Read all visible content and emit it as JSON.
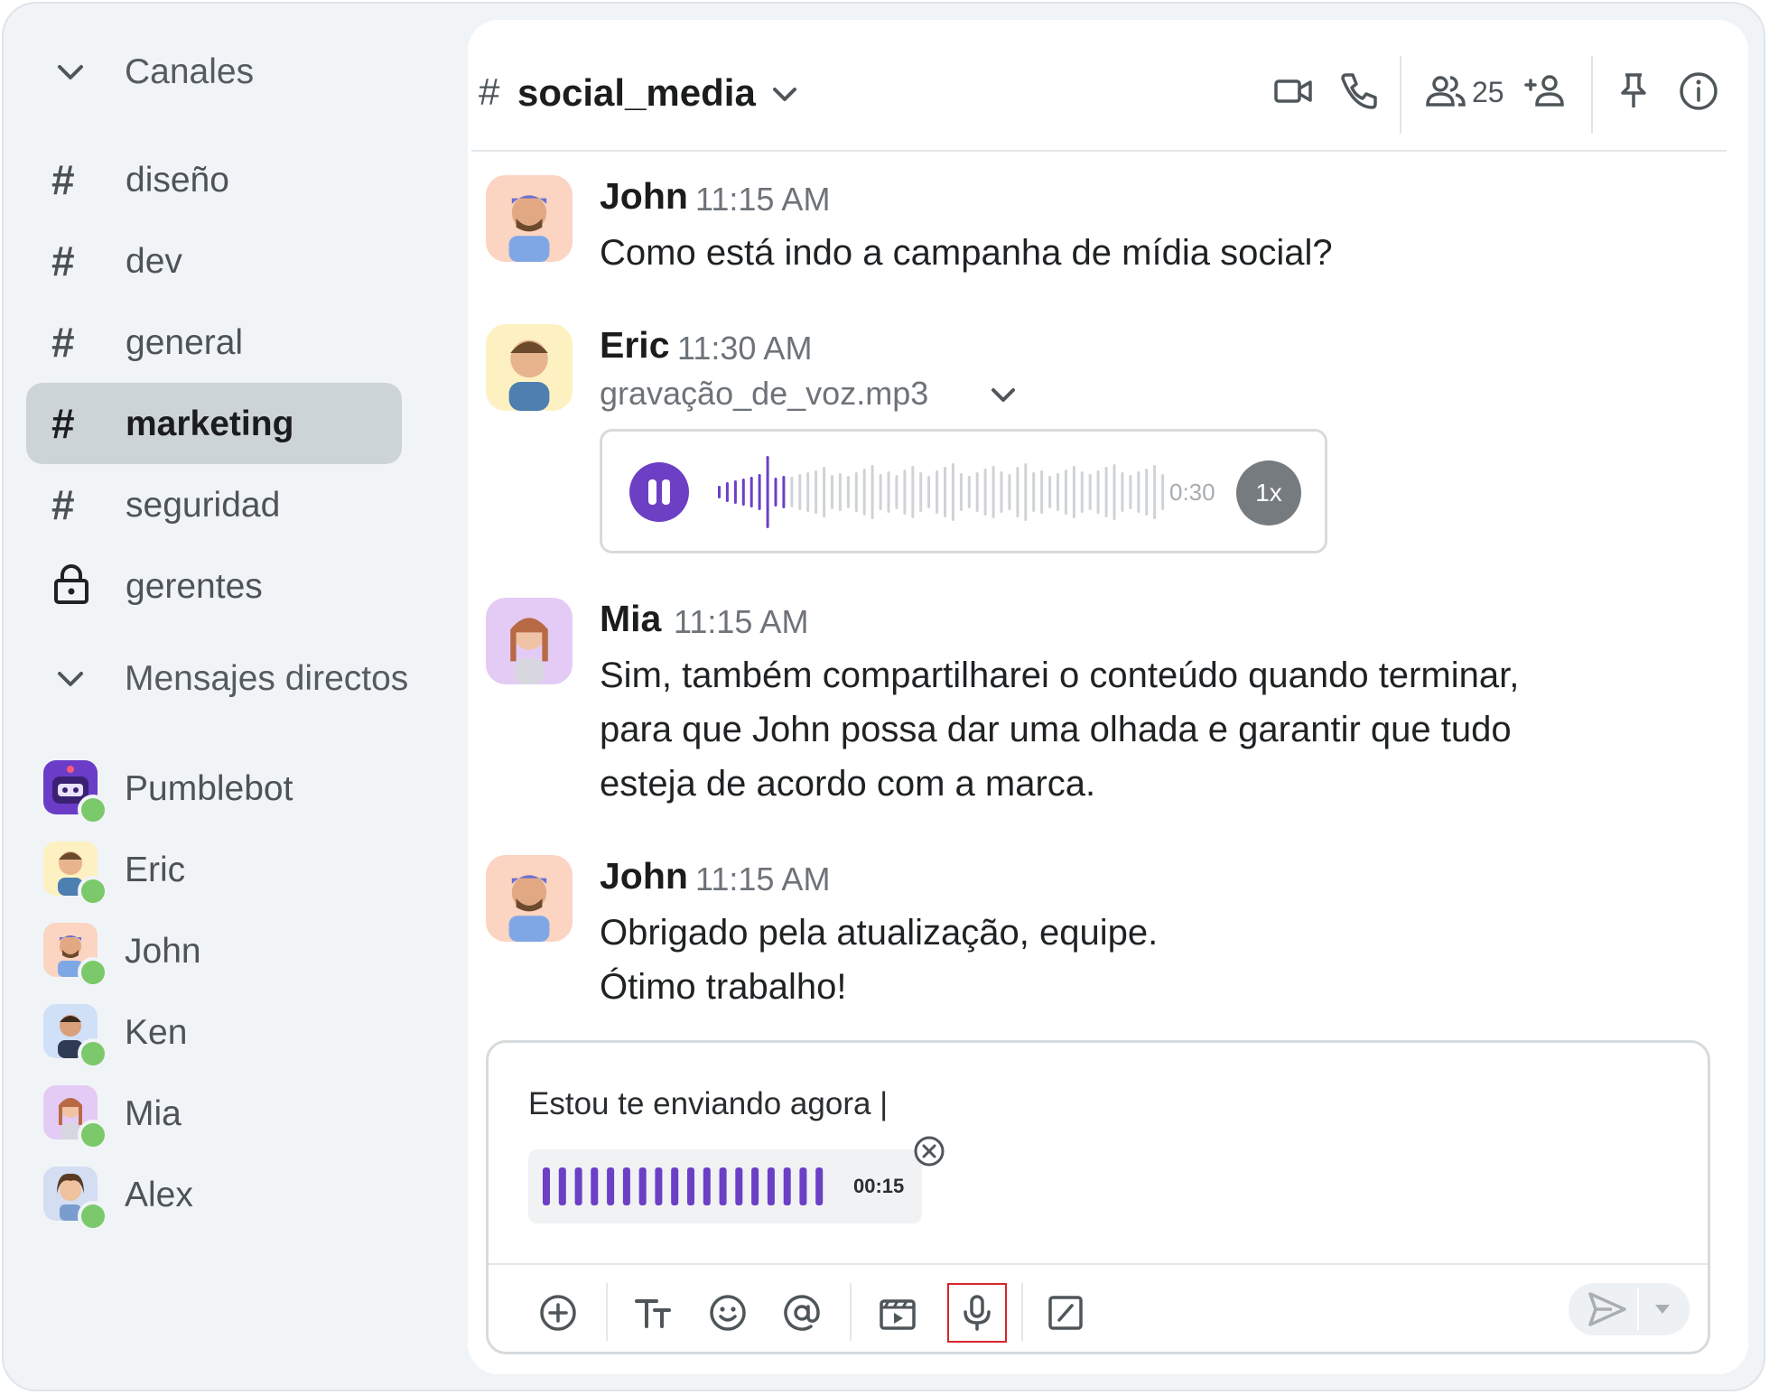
{
  "sidebar": {
    "channels_header": "Canales",
    "channels": [
      {
        "symbol": "#",
        "label": "diseño"
      },
      {
        "symbol": "#",
        "label": "dev"
      },
      {
        "symbol": "#",
        "label": "general"
      },
      {
        "symbol": "#",
        "label": "marketing",
        "active": true
      },
      {
        "symbol": "#",
        "label": "seguridad"
      },
      {
        "symbol": "lock-icon",
        "label": "gerentes"
      }
    ],
    "dm_header": "Mensajes directos",
    "direct_messages": [
      {
        "name": "Pumblebot",
        "status": "online"
      },
      {
        "name": "Eric",
        "status": "online"
      },
      {
        "name": "John",
        "status": "online"
      },
      {
        "name": "Ken",
        "status": "online"
      },
      {
        "name": "Mia",
        "status": "online"
      },
      {
        "name": "Alex",
        "status": "online"
      }
    ]
  },
  "channel": {
    "hash": "#",
    "name": "social_media",
    "member_count": "25",
    "icons": [
      "video-camera-icon",
      "phone-icon",
      "members-icon",
      "add-member-icon",
      "pin-icon",
      "info-icon"
    ]
  },
  "messages": [
    {
      "author": "John",
      "time": "11:15 AM",
      "text": "Como está indo a campanha de mídia social?"
    },
    {
      "author": "Eric",
      "time": "11:30 AM",
      "attachment": {
        "filename": "gravação_de_voz.mp3",
        "duration": "0:30",
        "speed": "1x",
        "progress": 0.16
      }
    },
    {
      "author": "Mia",
      "time": "11:15 AM",
      "lines": [
        "Sim, também compartilharei o conteúdo quando terminar,",
        "para que John possa dar uma olhada e garantir que tudo",
        "esteja de acordo com a marca."
      ]
    },
    {
      "author": "John",
      "time": "11:15 AM",
      "lines": [
        "Obrigado pela atualização, equipe.",
        "Ótimo trabalho!"
      ]
    }
  ],
  "composer": {
    "input_value": "Estou te enviando agora |",
    "recording_time": "00:15",
    "toolbar": [
      "add-icon",
      "text-format-icon",
      "emoji-icon",
      "mention-icon",
      "media-icon",
      "microphone-icon",
      "slash-command-icon"
    ],
    "send": "send-icon"
  },
  "colors": {
    "accent": "#6c3fc5",
    "active_channel_bg": "#cdd4d7",
    "online": "#7bc96a",
    "highlight_border": "#d7262c"
  }
}
